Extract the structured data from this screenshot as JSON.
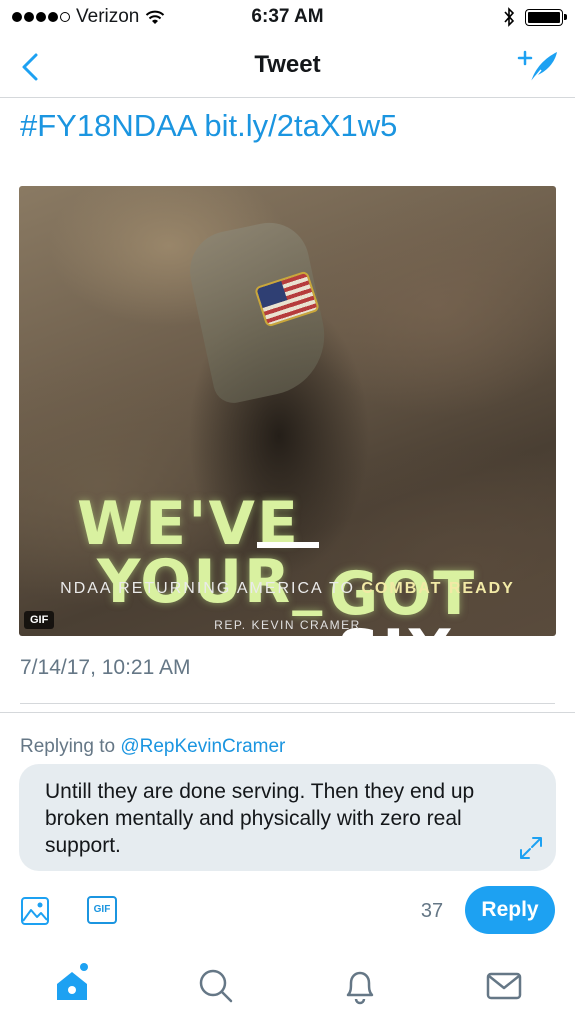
{
  "status_bar": {
    "carrier": "Verizon",
    "time": "6:37 AM"
  },
  "nav": {
    "title": "Tweet"
  },
  "tweet": {
    "link_text": "#FY18NDAA bit.ly/2taX1w5",
    "media": {
      "headline_line1_left": "WE'VE",
      "headline_line1_right": "GOT",
      "headline_line2_left": "YOUR_",
      "headline_line2_right": "SIX",
      "subline_plain": "NDAA RETURNING AMERICA TO ",
      "subline_bold": "COMBAT READY",
      "credit": "REP. KEVIN CRAMER",
      "badge": "GIF"
    },
    "timestamp": "7/14/17, 10:21 AM"
  },
  "reply": {
    "replying_prefix": "Replying to ",
    "replying_handle": "@RepKevinCramer",
    "draft_text": "Untill they are done serving. Then they end up broken mentally and physically with zero real support.",
    "gif_button_label": "GIF",
    "char_count": "37",
    "reply_button_label": "Reply"
  },
  "colors": {
    "accent": "#1da1f2",
    "link": "#1b95e0",
    "muted": "#657786"
  },
  "tab_bar": {
    "items": [
      "home-icon",
      "search-icon",
      "notifications-icon",
      "messages-icon"
    ],
    "active": "home-icon"
  }
}
